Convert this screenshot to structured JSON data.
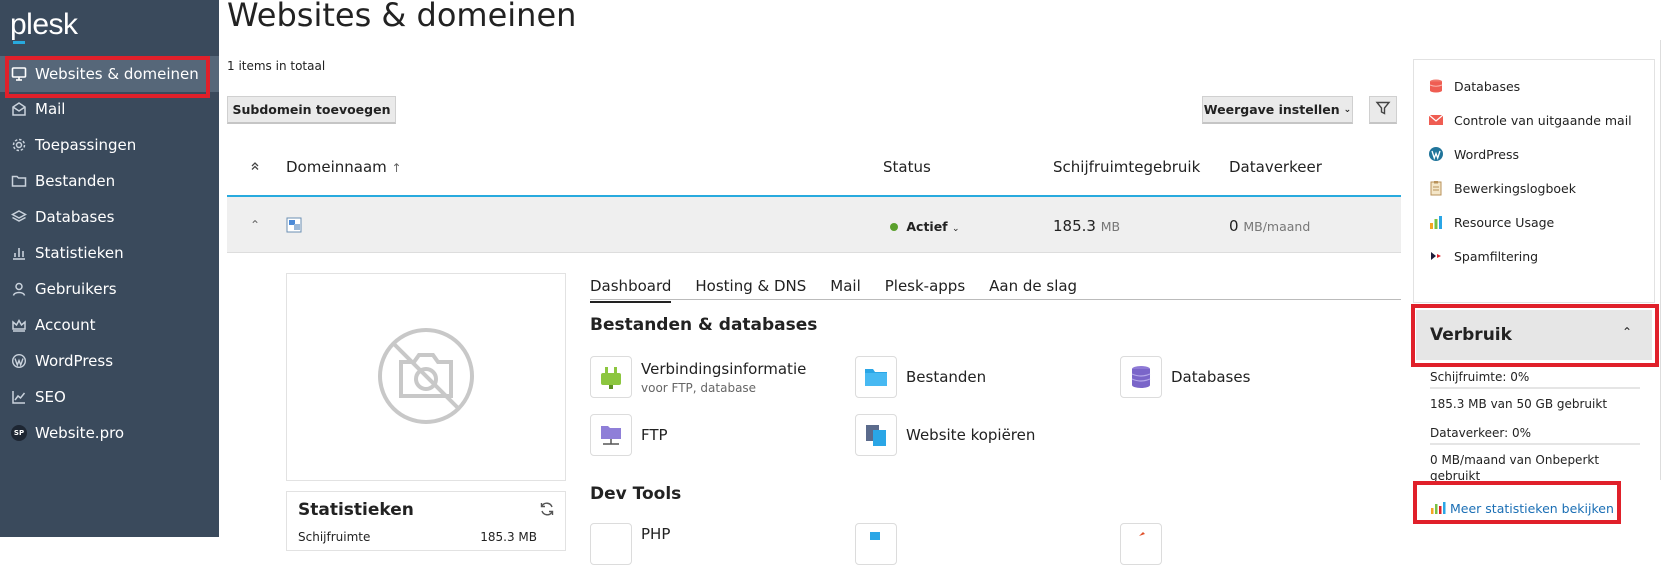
{
  "logo": {
    "text": "plesk"
  },
  "sidebar": {
    "items": [
      {
        "label": "Websites & domeinen",
        "icon": "monitor-icon"
      },
      {
        "label": "Mail",
        "icon": "mail-icon"
      },
      {
        "label": "Toepassingen",
        "icon": "gear-icon"
      },
      {
        "label": "Bestanden",
        "icon": "folder-icon"
      },
      {
        "label": "Databases",
        "icon": "layers-icon"
      },
      {
        "label": "Statistieken",
        "icon": "bar-chart-icon"
      },
      {
        "label": "Gebruikers",
        "icon": "user-icon"
      },
      {
        "label": "Account",
        "icon": "crown-icon"
      },
      {
        "label": "WordPress",
        "icon": "wordpress-icon"
      },
      {
        "label": "SEO",
        "icon": "trend-chart-icon"
      },
      {
        "label": "Website.pro",
        "icon": "sp-badge-icon"
      }
    ],
    "sp_badge": "SP"
  },
  "page": {
    "title": "Websites & domeinen",
    "total": "1 items in totaal",
    "add_subdomain": "Subdomein toevoegen",
    "view_settings": "Weergave instellen"
  },
  "table": {
    "col_domain": "Domeinnaam",
    "sort_arrow": "↑",
    "col_status": "Status",
    "col_disk": "Schijfruimtegebruik",
    "col_traffic": "Dataverkeer",
    "row": {
      "status": "Actief",
      "disk_value": "185.3",
      "disk_unit": "MB",
      "traffic_value": "0",
      "traffic_unit": "MB/maand"
    }
  },
  "tabs": [
    "Dashboard",
    "Hosting & DNS",
    "Mail",
    "Plesk-apps",
    "Aan de slag"
  ],
  "sections": {
    "files_db": "Bestanden & databases",
    "dev_tools": "Dev Tools"
  },
  "tools": {
    "connection": {
      "label": "Verbindingsinformatie",
      "sub": "voor FTP, database"
    },
    "files": {
      "label": "Bestanden"
    },
    "databases": {
      "label": "Databases"
    },
    "ftp": {
      "label": "FTP"
    },
    "copy_site": {
      "label": "Website kopiëren"
    },
    "php": {
      "label": "PHP"
    }
  },
  "stats_card": {
    "title": "Statistieken",
    "row_label": "Schijfruimte",
    "row_value": "185.3 MB"
  },
  "side_links": [
    {
      "label": "Databases",
      "icon": "database-icon"
    },
    {
      "label": "Controle van uitgaande mail",
      "icon": "mail-icon"
    },
    {
      "label": "WordPress",
      "icon": "wordpress-icon"
    },
    {
      "label": "Bewerkingslogboek",
      "icon": "clipboard-icon"
    },
    {
      "label": "Resource Usage",
      "icon": "bar-chart-icon"
    },
    {
      "label": "Spamfiltering",
      "icon": "spam-filter-icon"
    }
  ],
  "usage": {
    "title": "Verbruik",
    "disk_label": "Schijfruimte: 0%",
    "disk_detail": "185.3 MB van 50 GB gebruikt",
    "traffic_label": "Dataverkeer: 0%",
    "traffic_detail_1": "0 MB/maand van Onbeperkt",
    "traffic_detail_2": "gebruikt",
    "more_stats": "Meer statistieken bekijken"
  },
  "colors": {
    "sidebar": "#3a4a5c",
    "active": "#566779",
    "accent": "#28aade",
    "highlight": "#e0202a",
    "status_ok": "#5aa02c"
  }
}
